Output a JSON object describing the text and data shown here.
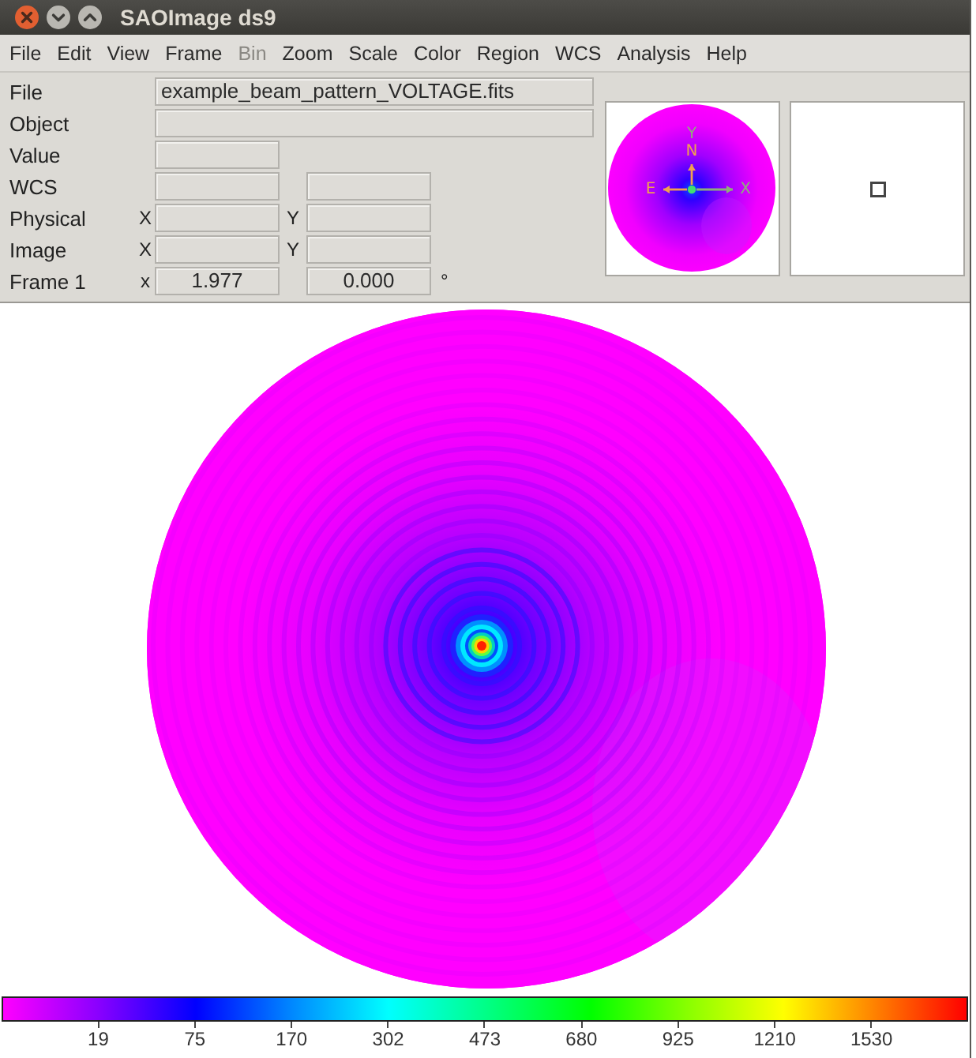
{
  "window": {
    "title": "SAOImage ds9"
  },
  "menu": [
    {
      "label": "File",
      "disabled": false
    },
    {
      "label": "Edit",
      "disabled": false
    },
    {
      "label": "View",
      "disabled": false
    },
    {
      "label": "Frame",
      "disabled": false
    },
    {
      "label": "Bin",
      "disabled": true
    },
    {
      "label": "Zoom",
      "disabled": false
    },
    {
      "label": "Scale",
      "disabled": false
    },
    {
      "label": "Color",
      "disabled": false
    },
    {
      "label": "Region",
      "disabled": false
    },
    {
      "label": "WCS",
      "disabled": false
    },
    {
      "label": "Analysis",
      "disabled": false
    },
    {
      "label": "Help",
      "disabled": false
    }
  ],
  "info_panel": {
    "rows": [
      {
        "label": "File",
        "kind": "wide",
        "value": "example_beam_pattern_VOLTAGE.fits"
      },
      {
        "label": "Object",
        "kind": "wide"
      },
      {
        "label": "Value",
        "kind": "single"
      },
      {
        "label": "WCS",
        "kind": "pair"
      },
      {
        "label": "Physical",
        "kind": "pair",
        "first_axis": "X",
        "second_axis": "Y"
      },
      {
        "label": "Image",
        "kind": "pair",
        "first_axis": "X",
        "second_axis": "Y"
      },
      {
        "label": "Frame 1",
        "kind": "pair",
        "first_axis": "x",
        "values": [
          "1.977",
          "0.000"
        ],
        "unit": "°"
      }
    ]
  },
  "panner": {
    "compass": [
      {
        "kind": "y",
        "label": "Y",
        "color": "#8fae7a"
      },
      {
        "kind": "north",
        "label": "N",
        "color": "#f0a050"
      },
      {
        "kind": "east",
        "label": "E",
        "color": "#f0a050"
      },
      {
        "kind": "x",
        "label": "X",
        "color": "#8fae7a"
      }
    ]
  },
  "colorbar": {
    "tick_labels": [
      "19",
      "75",
      "170",
      "302",
      "473",
      "680",
      "925",
      "1210",
      "1530"
    ]
  }
}
